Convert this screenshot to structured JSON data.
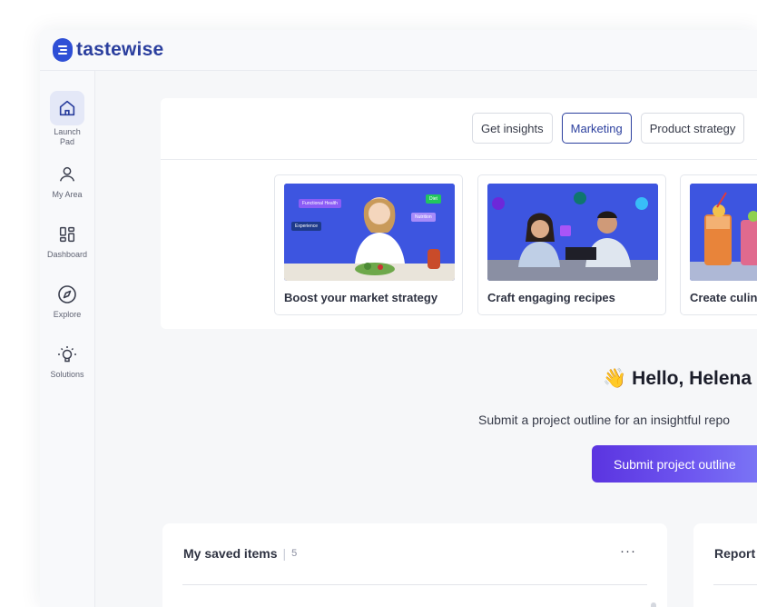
{
  "brand": {
    "name": "tastewise",
    "color": "#2e4fd6"
  },
  "sidebar": {
    "items": [
      {
        "label": "Launch Pad",
        "icon": "home-icon",
        "active": true
      },
      {
        "label": "My Area",
        "icon": "user-icon"
      },
      {
        "label": "Dashboard",
        "icon": "dashboard-icon"
      },
      {
        "label": "Explore",
        "icon": "compass-icon"
      },
      {
        "label": "Solutions",
        "icon": "lightbulb-icon"
      }
    ]
  },
  "tabs": [
    {
      "label": "Get insights"
    },
    {
      "label": "Marketing",
      "active": true
    },
    {
      "label": "Product strategy"
    }
  ],
  "use_cases": [
    {
      "title": "Boost your market strategy",
      "chips": [
        "Functional Health",
        "Diet",
        "Nutrition",
        "Experience"
      ]
    },
    {
      "title": "Craft engaging recipes"
    },
    {
      "title": "Create culina"
    }
  ],
  "greeting": {
    "emoji": "👋",
    "text": "Hello, Helena"
  },
  "subtitle": "Submit a project outline for an insightful repo",
  "submit_button": "Submit project outline",
  "saved": {
    "title": "My saved items",
    "count": "5",
    "more": "···"
  },
  "reports": {
    "title": "Report"
  },
  "colors": {
    "accent": "#2b3f9e",
    "button_start": "#5b34e0",
    "button_end": "#7d7bf6",
    "image_blue": "#3d55e0"
  }
}
